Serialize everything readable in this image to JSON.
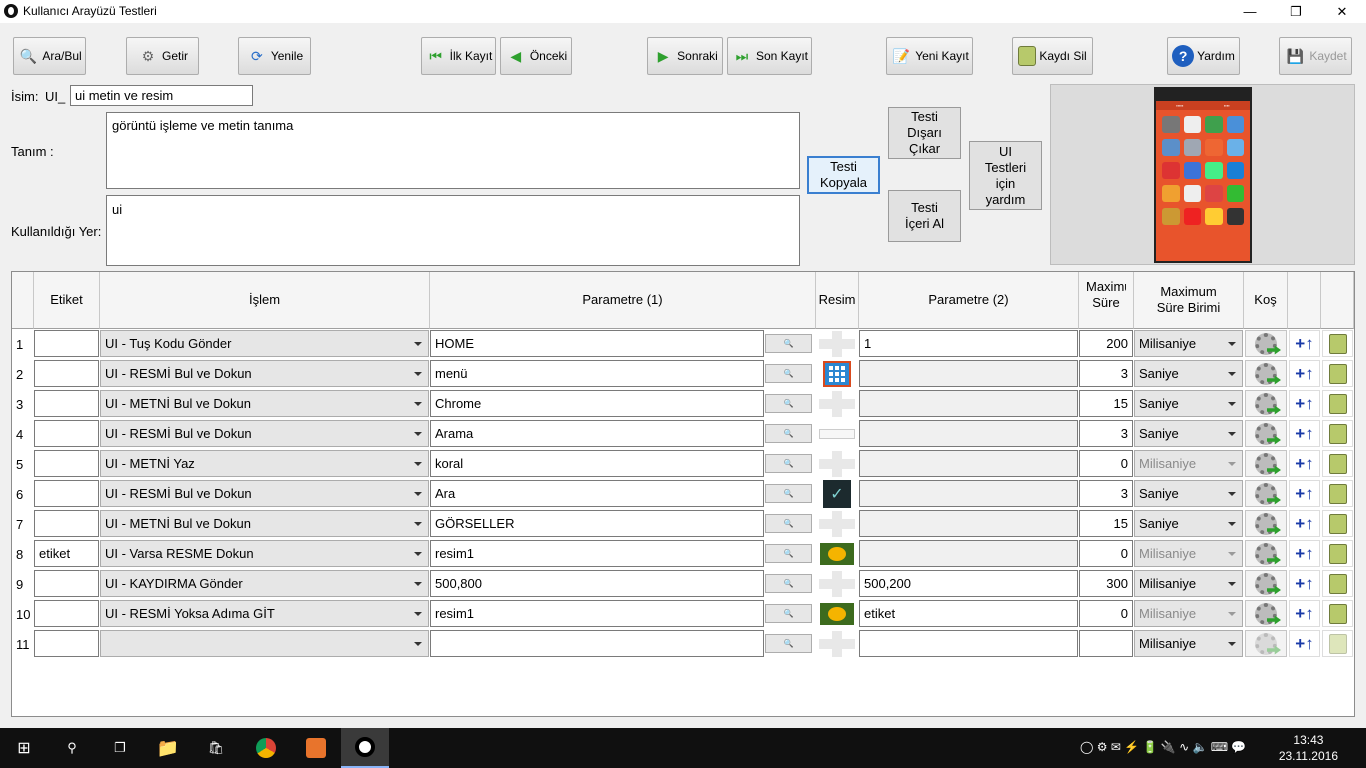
{
  "window": {
    "title": "Kullanıcı Arayüzü Testleri",
    "minimize": "—",
    "maximize": "❐",
    "close": "✕"
  },
  "toolbar": {
    "search": "Ara/Bul",
    "fetch": "Getir",
    "refresh": "Yenile",
    "first": "İlk Kayıt",
    "prev": "Önceki",
    "next": "Sonraki",
    "last": "Son Kayıt",
    "new": "Yeni Kayıt",
    "delete": "Kaydı Sil",
    "help": "Yardım",
    "save": "Kaydet"
  },
  "form": {
    "name_label": "İsim:",
    "name_prefix": "UI_",
    "name_value": "ui metin ve resim",
    "desc_label": "Tanım :",
    "desc_value": "görüntü işleme ve metin tanıma",
    "usage_label": "Kullanıldığı Yer:",
    "usage_value": "ui",
    "copy_test": "Testi Kopyala",
    "export_test": "Testi Dışarı Çıkar",
    "import_test": "Testi İçeri Al",
    "ui_help": "UI Testleri için yardım"
  },
  "grid": {
    "headers": {
      "label": "Etiket",
      "operation": "İşlem",
      "param1": "Parametre (1)",
      "image": "Resim",
      "param2": "Parametre (2)",
      "max_time": "Maximum Süre",
      "max_time_unit": "Maximum Süre Birimi",
      "run": "Koş"
    },
    "rows": [
      {
        "n": "1",
        "label": "",
        "op": "UI - Tuş Kodu Gönder",
        "p1": "HOME",
        "img": "none",
        "p2": "1",
        "time": "200",
        "unit": "Milisaniye",
        "unit_disabled": false
      },
      {
        "n": "2",
        "label": "",
        "op": "UI - RESMİ Bul ve Dokun",
        "p1": "menü",
        "img": "apps-grid",
        "p2": "",
        "time": "3",
        "unit": "Saniye",
        "unit_disabled": false
      },
      {
        "n": "3",
        "label": "",
        "op": "UI - METNİ Bul ve Dokun",
        "p1": "Chrome",
        "img": "none",
        "p2": "",
        "time": "15",
        "unit": "Saniye",
        "unit_disabled": false
      },
      {
        "n": "4",
        "label": "",
        "op": "UI - RESMİ Bul ve Dokun",
        "p1": "Arama",
        "img": "search-bar",
        "p2": "",
        "time": "3",
        "unit": "Saniye",
        "unit_disabled": false
      },
      {
        "n": "5",
        "label": "",
        "op": "UI - METNİ Yaz",
        "p1": "koral",
        "img": "none",
        "p2": "",
        "time": "0",
        "unit": "Milisaniye",
        "unit_disabled": true
      },
      {
        "n": "6",
        "label": "",
        "op": "UI - RESMİ Bul ve Dokun",
        "p1": "Ara",
        "img": "check-dark",
        "p2": "",
        "time": "3",
        "unit": "Saniye",
        "unit_disabled": false
      },
      {
        "n": "7",
        "label": "",
        "op": "UI - METNİ Bul ve Dokun",
        "p1": "GÖRSELLER",
        "img": "none",
        "p2": "",
        "time": "15",
        "unit": "Saniye",
        "unit_disabled": false
      },
      {
        "n": "8",
        "label": "etiket",
        "op": "UI - Varsa RESME Dokun",
        "p1": "resim1",
        "img": "flower",
        "p2": "",
        "time": "0",
        "unit": "Milisaniye",
        "unit_disabled": true
      },
      {
        "n": "9",
        "label": "",
        "op": "UI - KAYDIRMA Gönder",
        "p1": "500,800",
        "img": "none",
        "p2": "500,200",
        "time": "300",
        "unit": "Milisaniye",
        "unit_disabled": false
      },
      {
        "n": "10",
        "label": "",
        "op": "UI - RESMİ Yoksa Adıma GİT",
        "p1": "resim1",
        "img": "flower",
        "p2": "etiket",
        "time": "0",
        "unit": "Milisaniye",
        "unit_disabled": true
      },
      {
        "n": "11",
        "label": "",
        "op": "",
        "p1": "",
        "img": "none",
        "p2": "",
        "time": "",
        "unit": "Milisaniye",
        "unit_disabled": false
      }
    ]
  },
  "taskbar": {
    "time": "13:43",
    "date": "23.11.2016"
  }
}
